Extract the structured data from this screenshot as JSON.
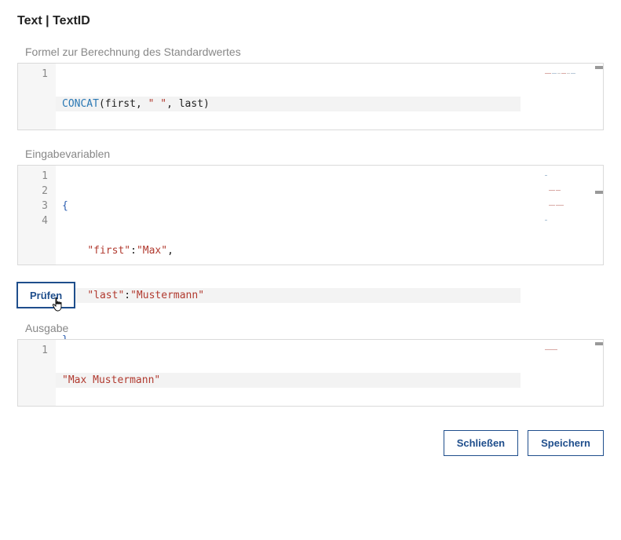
{
  "title": "Text | TextID",
  "sections": {
    "formula": {
      "label": "Formel zur Berechnung des Standardwertes",
      "code": {
        "line_numbers": [
          "1"
        ],
        "tokens": {
          "fn": "CONCAT",
          "lp": "(",
          "a1": "first",
          "c1": ", ",
          "s1": "\" \"",
          "c2": ", ",
          "a2": "last",
          "rp": ")"
        }
      }
    },
    "vars": {
      "label": "Eingabevariablen",
      "code": {
        "line_numbers": [
          "1",
          "2",
          "3",
          "4"
        ],
        "lines": {
          "l1_open": "{",
          "l2_key": "\"first\"",
          "l2_colon": ":",
          "l2_val": "\"Max\"",
          "l2_comma": ",",
          "l3_key": "\"last\"",
          "l3_colon": ":",
          "l3_val": "\"Mustermann\"",
          "l4_close": "}"
        }
      }
    },
    "output": {
      "label": "Ausgabe",
      "code": {
        "line_numbers": [
          "1"
        ],
        "value": "\"Max Mustermann\""
      }
    }
  },
  "buttons": {
    "check": "Prüfen",
    "close": "Schließen",
    "save": "Speichern"
  },
  "colors": {
    "accent": "#1f4e8c",
    "border": "#dadada",
    "label": "#878787",
    "string": "#b13a2f",
    "func": "#2a78b4"
  }
}
